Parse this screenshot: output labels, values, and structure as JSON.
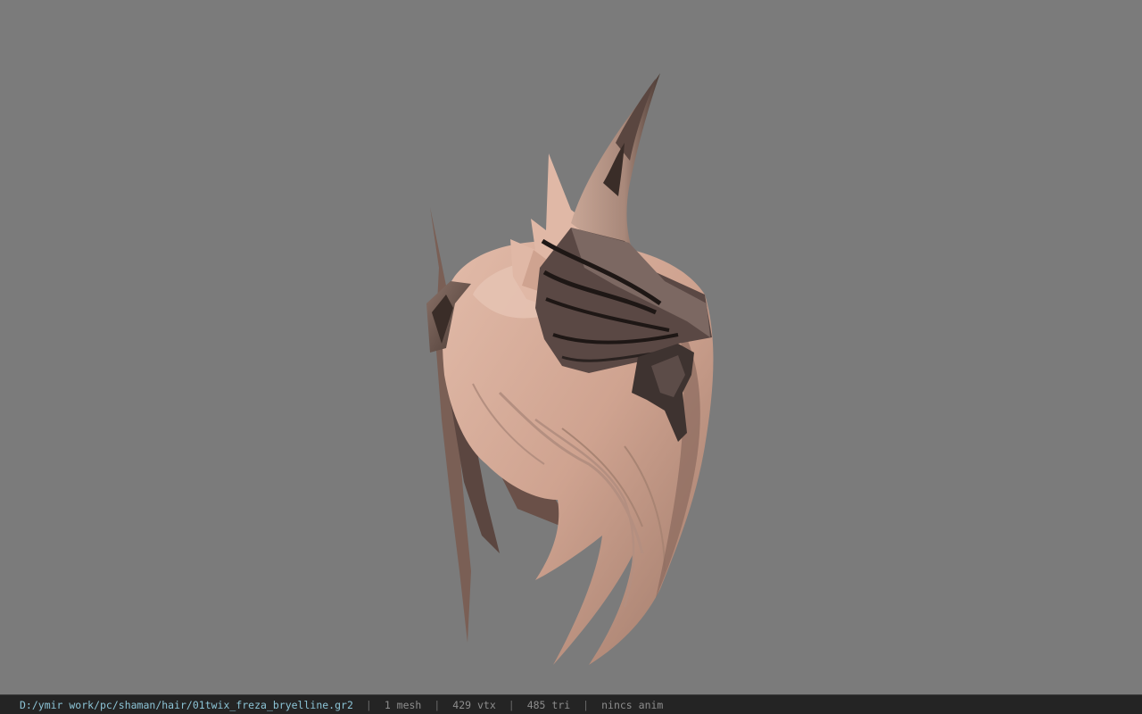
{
  "viewer": {
    "background_color": "#7b7b7b",
    "model_icon": "hair-model-render"
  },
  "statusbar": {
    "file_path": "D:/ymir work/pc/shaman/hair/01twix_freza_bryelline.gr2",
    "separator": "|",
    "mesh_count": "1 mesh",
    "vertex_count": "429 vtx",
    "triangle_count": "485 tri",
    "animation_status": "nincs anim",
    "path_color": "#8cc4d6",
    "text_color": "#8d8d8d"
  }
}
